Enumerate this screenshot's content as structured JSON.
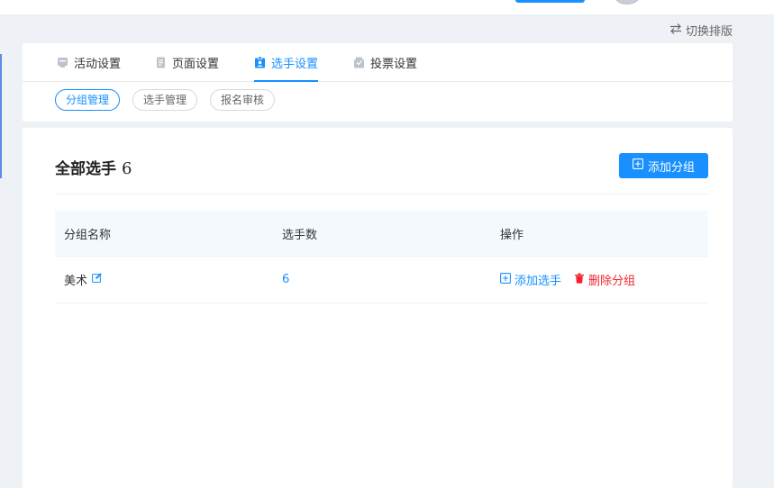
{
  "header": {
    "switch_layout_label": "切换排版",
    "switch_icon": "swap-arrows-icon"
  },
  "main_tabs": [
    {
      "label": "活动设置",
      "icon": "activity-icon",
      "active": false
    },
    {
      "label": "页面设置",
      "icon": "page-icon",
      "active": false
    },
    {
      "label": "选手设置",
      "icon": "contestant-icon",
      "active": true
    },
    {
      "label": "投票设置",
      "icon": "vote-icon",
      "active": false
    }
  ],
  "sub_tabs": [
    {
      "label": "分组管理",
      "active": true
    },
    {
      "label": "选手管理",
      "active": false
    },
    {
      "label": "报名审核",
      "active": false
    }
  ],
  "panel": {
    "title": "全部选手",
    "count": "6",
    "add_group_label": "添加分组"
  },
  "table": {
    "columns": [
      "分组名称",
      "选手数",
      "操作"
    ],
    "rows": [
      {
        "name": "美术",
        "contestants": "6",
        "add_label": "添加选手",
        "delete_label": "删除分组"
      }
    ]
  },
  "colors": {
    "primary": "#1890ff",
    "danger": "#f5222d",
    "page_bg": "#eef1f5",
    "table_header_bg": "#f4f9fd"
  }
}
